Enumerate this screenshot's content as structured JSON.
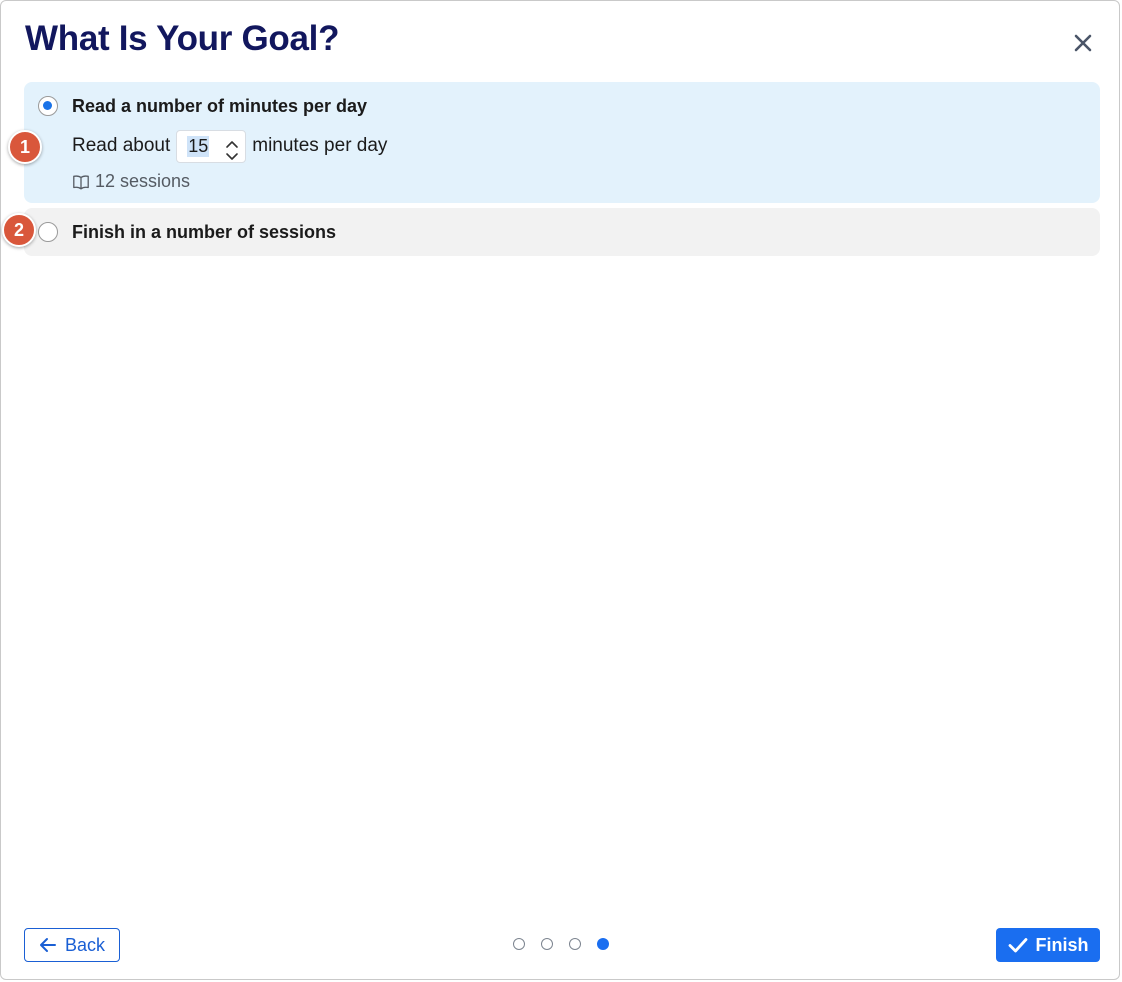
{
  "dialog": {
    "title": "What Is Your Goal?"
  },
  "options": [
    {
      "label": "Read a number of minutes per day",
      "selected": true,
      "read_prefix": "Read about",
      "minutes_value": "15",
      "read_suffix": "minutes per day",
      "sessions_text": "12 sessions"
    },
    {
      "label": "Finish in a number of sessions",
      "selected": false
    }
  ],
  "markers": [
    "1",
    "2"
  ],
  "footer": {
    "back_label": "Back",
    "finish_label": "Finish",
    "steps_total": 4,
    "current_step": 4
  },
  "icons": {
    "close": "close-icon",
    "book": "book-icon",
    "back": "arrow-left-icon",
    "finish": "check-icon",
    "stepper_up": "chevron-up-icon",
    "stepper_down": "chevron-down-icon"
  },
  "colors": {
    "title": "#12175e",
    "accent": "#1a6ef0",
    "selected_option_bg": "#e3f2fc",
    "unselected_option_bg": "#f2f2f2",
    "marker": "#d9573b"
  }
}
